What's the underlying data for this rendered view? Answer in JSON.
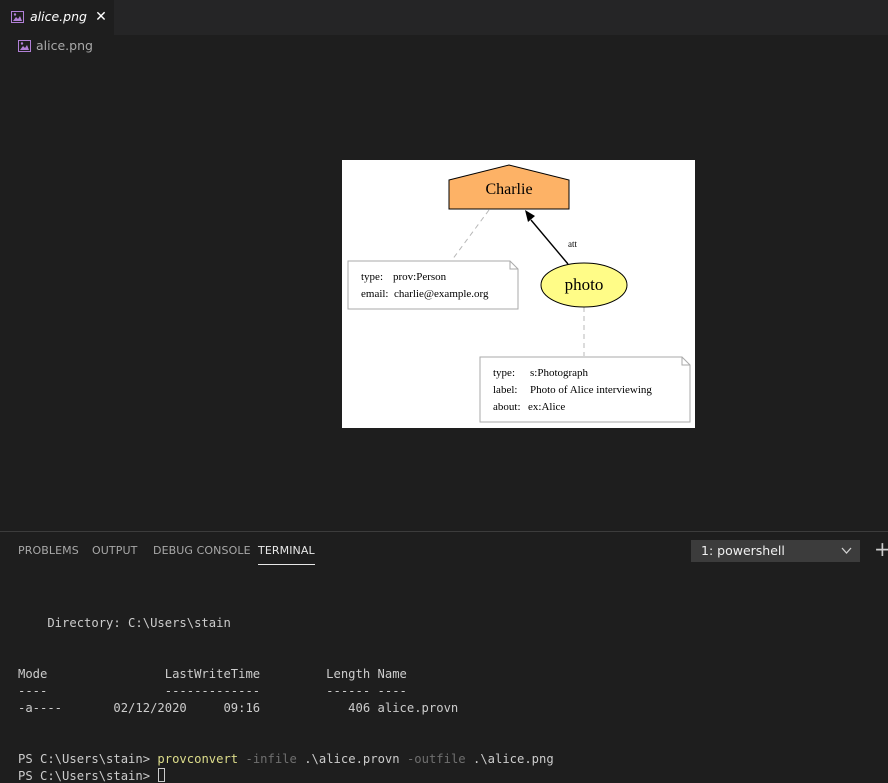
{
  "tab": {
    "title": "alice.png",
    "close": "✕"
  },
  "breadcrumb": {
    "file": "alice.png"
  },
  "diagram": {
    "agent": "Charlie",
    "entity": "photo",
    "edge_label": "att",
    "agent_note": {
      "type_key": "type:",
      "type_val": "prov:Person",
      "email_key": "email:",
      "email_val": "charlie@example.org"
    },
    "entity_note": {
      "type_key": "type:",
      "type_val": "s:Photograph",
      "label_key": "label:",
      "label_val": "Photo of Alice interviewing",
      "about_key": "about:",
      "about_val": "ex:Alice"
    },
    "colors": {
      "agent_fill": "#fdb266",
      "entity_fill": "#fffc87"
    }
  },
  "panel": {
    "tabs": [
      "PROBLEMS",
      "OUTPUT",
      "DEBUG CONSOLE",
      "TERMINAL"
    ],
    "active_tab": "TERMINAL",
    "terminal_select": "1: powershell",
    "plus": "+"
  },
  "terminal": {
    "directory": "    Directory: C:\\Users\\stain",
    "headers": "Mode                LastWriteTime         Length Name",
    "rule": "----                -------------         ------ ----",
    "row": "-a----       02/12/2020     09:16            406 alice.provn",
    "prompt": "PS C:\\Users\\stain>",
    "cmd": "provconvert",
    "flag1": "-infile",
    "arg1": ".\\alice.provn",
    "flag2": "-outfile",
    "arg2": ".\\alice.png",
    "prompt2": "PS C:\\Users\\stain>"
  }
}
